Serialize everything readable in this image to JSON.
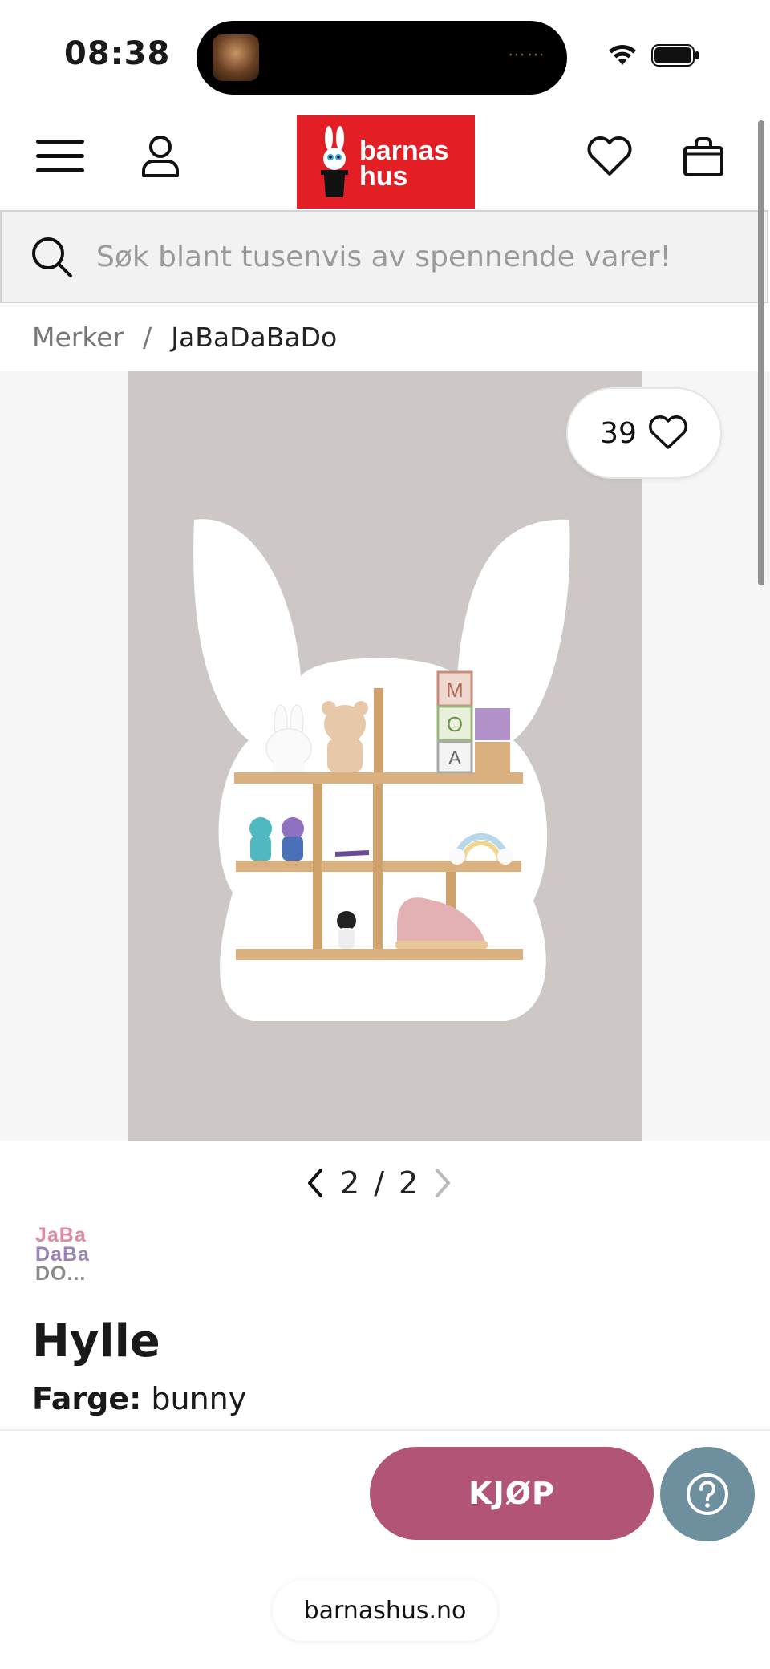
{
  "status_bar": {
    "time": "08:38"
  },
  "header": {
    "logo_text_line1": "barnas",
    "logo_text_line2": "hus",
    "brand_color": "#e31e24"
  },
  "search": {
    "placeholder": "Søk blant tusenvis av spennende varer!"
  },
  "breadcrumb": {
    "parent": "Merker",
    "separator": "/",
    "current": "JaBaDaBaDo"
  },
  "gallery": {
    "like_count": "39",
    "pager_current": "2",
    "pager_separator": "/",
    "pager_total": "2"
  },
  "product": {
    "brand_logo_rows": [
      "JaBa",
      "DaBa",
      "DO..."
    ],
    "title": "Hylle",
    "color_label": "Farge:",
    "color_value": "bunny"
  },
  "actions": {
    "buy_label": "KJØP",
    "buy_color": "#b15477",
    "help_color": "#6d8f9e"
  },
  "browser": {
    "url": "barnashus.no"
  }
}
